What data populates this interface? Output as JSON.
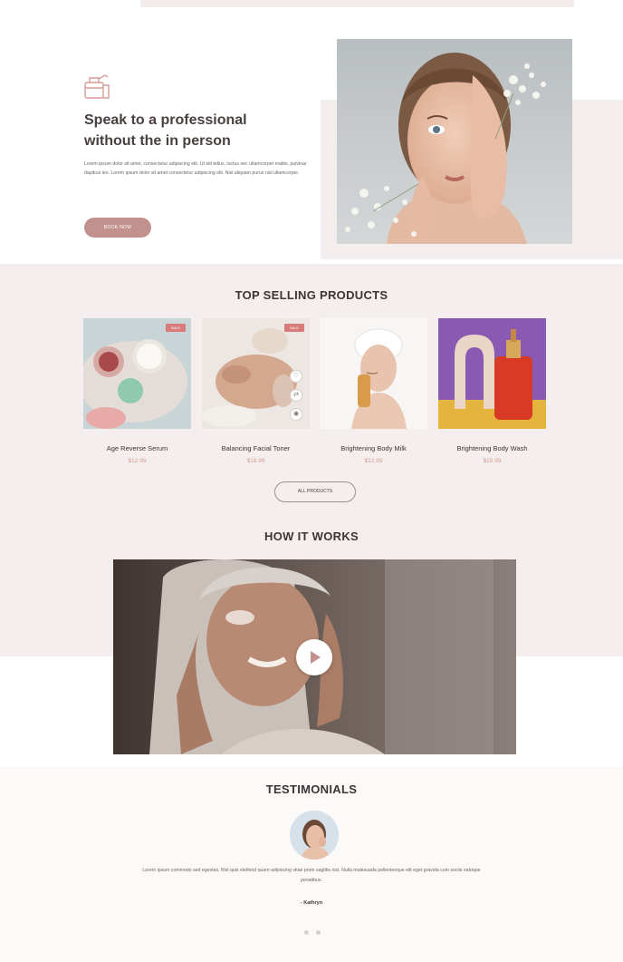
{
  "hero": {
    "title": "Speak to a professional without the in person",
    "body": "Lorem ipsum dolor sit amet, consectetur adipiscing elit. Ut elit tellus, luctus nec ullamcorper mattis, pulvinar dapibus leo. Lorem ipsum dolor sit amet consectetur adipiscing elit. Nisl aliquam purus nisl ullamcorper.",
    "button_label": "BOOK NOW",
    "icon": "spray-bottle-icon"
  },
  "products": {
    "heading": "TOP SELLING PRODUCTS",
    "items": [
      {
        "name": "Age Reverse Serum",
        "price": "$12.99",
        "badge": "SALE"
      },
      {
        "name": "Balancing Facial Toner",
        "price": "$18.99",
        "badge": "SALE"
      },
      {
        "name": "Brightening Body Milk",
        "price": "$12.99",
        "badge": ""
      },
      {
        "name": "Brightening Body Wash",
        "price": "$15.99",
        "badge": ""
      }
    ],
    "all_button_label": "ALL PRODUCTS",
    "quick_icons": [
      "wishlist-icon",
      "compare-icon",
      "quick-view-icon"
    ]
  },
  "how_it_works": {
    "heading": "HOW IT WORKS",
    "play_icon": "play-icon"
  },
  "testimonials": {
    "heading": "TESTIMONIALS",
    "quote": "Lorem ipsum commodo sed egestas. Nisl quis eleifend quam adipiscing vitae proin sagittis nisl. Nulla malesuada pellentesque elit eget gravida cum sociis natoque penatibus.",
    "author": "- Kathryn"
  },
  "colors": {
    "accent": "#c3918d",
    "band": "#f4eeee",
    "heading": "#3d3535"
  }
}
